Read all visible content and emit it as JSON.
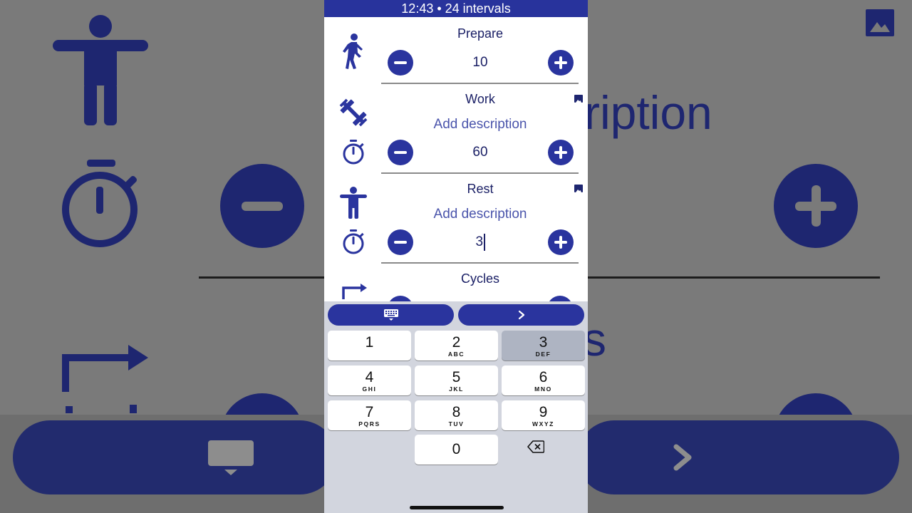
{
  "status_bar": {
    "title": "12:43 • 24 intervals"
  },
  "sections": {
    "prepare": {
      "title": "Prepare",
      "value": "10"
    },
    "work": {
      "title": "Work",
      "description_placeholder": "Add description",
      "value": "60"
    },
    "rest": {
      "title": "Rest",
      "description_placeholder": "Add description",
      "value": "3"
    },
    "cycles": {
      "title": "Cycles"
    }
  },
  "icons": {
    "prepare": "walking-person-icon",
    "work": "dumbbell-icon",
    "work_timer": "stopwatch-icon",
    "rest": "standing-person-icon",
    "rest_timer": "stopwatch-icon",
    "cycles": "repeat-icon",
    "image": "image-icon",
    "keyboard": "keyboard-icon",
    "next": "chevron-right-icon",
    "backspace": "backspace-icon"
  },
  "background": {
    "partial_text": "ription",
    "partial_text_2": "s"
  },
  "keypad": {
    "keys": [
      {
        "num": "1",
        "letters": ""
      },
      {
        "num": "2",
        "letters": "ABC"
      },
      {
        "num": "3",
        "letters": "DEF"
      },
      {
        "num": "4",
        "letters": "GHI"
      },
      {
        "num": "5",
        "letters": "JKL"
      },
      {
        "num": "6",
        "letters": "MNO"
      },
      {
        "num": "7",
        "letters": "PQRS"
      },
      {
        "num": "8",
        "letters": "TUV"
      },
      {
        "num": "9",
        "letters": "WXYZ"
      },
      {
        "num": "0",
        "letters": ""
      }
    ]
  },
  "colors": {
    "accent": "#2a349e",
    "text": "#1b2066",
    "placeholder": "#4a54ab",
    "keyboard_bg": "#d2d5de"
  }
}
